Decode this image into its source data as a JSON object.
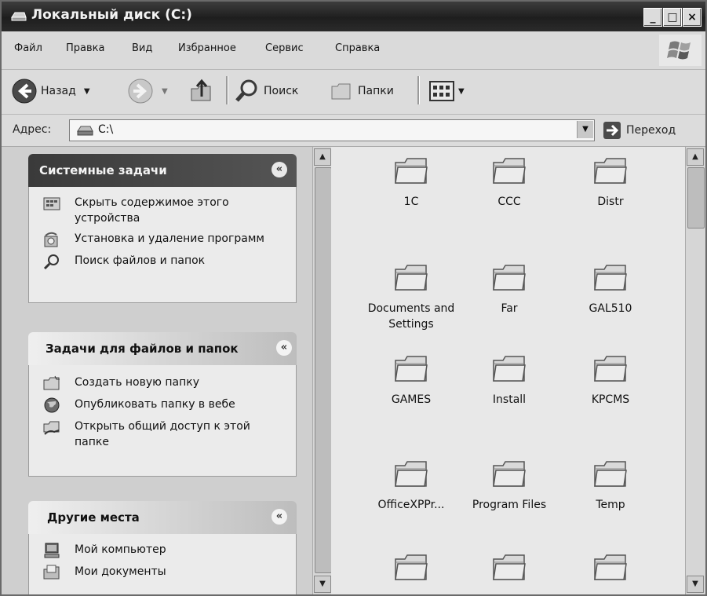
{
  "window": {
    "title": "Локальный диск (C:)",
    "controls": [
      "_",
      "□",
      "×"
    ]
  },
  "menu": [
    "Файл",
    "Правка",
    "Вид",
    "Избранное",
    "Сервис",
    "Справка"
  ],
  "toolbar": {
    "back_label": "Назад",
    "search_label": "Поиск",
    "folders_label": "Папки"
  },
  "address": {
    "label": "Адрес:",
    "value": "C:\\",
    "go_label": "Переход"
  },
  "left_pane": {
    "system_tasks": {
      "title": "Системные задачи",
      "items": [
        {
          "label": "Скрыть содержимое этого устройства",
          "icon": "hide-contents-icon"
        },
        {
          "label": "Установка и удаление программ",
          "icon": "add-remove-programs-icon"
        },
        {
          "label": "Поиск файлов и папок",
          "icon": "search-icon"
        }
      ]
    },
    "file_tasks": {
      "title": "Задачи для файлов и папок",
      "items": [
        {
          "label": "Создать новую папку",
          "icon": "new-folder-icon"
        },
        {
          "label": "Опубликовать папку в вебе",
          "icon": "globe-icon"
        },
        {
          "label": "Открыть общий доступ к этой папке",
          "icon": "share-folder-icon"
        }
      ]
    },
    "other_places": {
      "title": "Другие места",
      "items": [
        {
          "label": "Мой компьютер",
          "icon": "my-computer-icon"
        },
        {
          "label": "Мои документы",
          "icon": "my-documents-icon"
        }
      ]
    }
  },
  "files": [
    {
      "name": "1C"
    },
    {
      "name": "CCC"
    },
    {
      "name": "Distr"
    },
    {
      "name": "Documents and Settings"
    },
    {
      "name": "Far"
    },
    {
      "name": "GAL510"
    },
    {
      "name": "GAMES"
    },
    {
      "name": "Install"
    },
    {
      "name": "KPCMS"
    },
    {
      "name": "OfficeXPPr..."
    },
    {
      "name": "Program Files"
    },
    {
      "name": "Temp"
    },
    {
      "name": ""
    },
    {
      "name": ""
    },
    {
      "name": ""
    }
  ]
}
